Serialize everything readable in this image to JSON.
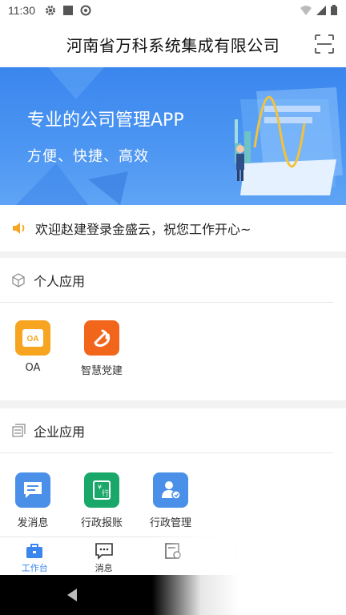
{
  "status_bar": {
    "time": "11:30"
  },
  "header": {
    "title": "河南省万科系统集成有限公司",
    "scan_icon": "scan-icon"
  },
  "banner": {
    "title": "专业的公司管理APP",
    "subtitle": "方便、快捷、高效"
  },
  "notice": {
    "text": "欢迎赵建登录金盛云，祝您工作开心~",
    "icon": "speaker-icon"
  },
  "personal": {
    "title": "个人应用",
    "apps": [
      {
        "label": "OA",
        "icon": "oa-icon",
        "color": "#f7a520"
      },
      {
        "label": "智慧党建",
        "icon": "party-icon",
        "color": "#f2661c"
      }
    ]
  },
  "enterprise": {
    "title": "企业应用",
    "apps": [
      {
        "label": "发消息",
        "icon": "message-icon",
        "color": "#4a90e8"
      },
      {
        "label": "行政报账",
        "icon": "reimburse-icon",
        "color": "#19a86a"
      },
      {
        "label": "行政管理",
        "icon": "admin-icon",
        "color": "#4a90e8"
      }
    ]
  },
  "tabbar": {
    "items": [
      {
        "label": "工作台",
        "icon": "briefcase-icon",
        "active": true
      },
      {
        "label": "消息",
        "icon": "chat-icon",
        "active": false
      },
      {
        "label": "",
        "icon": "report-icon",
        "active": false
      },
      {
        "label": "",
        "icon": "contacts-icon",
        "active": false
      },
      {
        "label": "",
        "icon": "profile-icon",
        "active": false
      }
    ]
  },
  "colors": {
    "accent": "#3a86ee",
    "banner": "#4d96f2"
  }
}
